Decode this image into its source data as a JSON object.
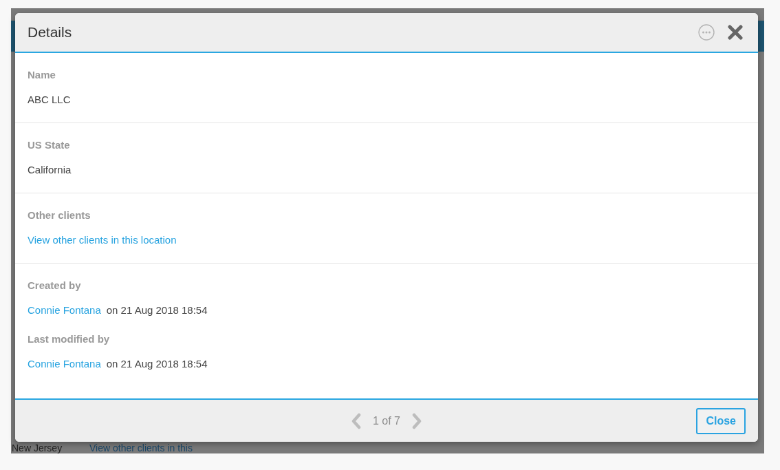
{
  "background": {
    "rows": [
      {
        "state": "New Jersey",
        "link": "View other clients in this"
      }
    ]
  },
  "dialog": {
    "title": "Details",
    "sections": [
      {
        "fields": [
          {
            "kind": "text",
            "label": "Name",
            "value": "ABC LLC"
          }
        ]
      },
      {
        "fields": [
          {
            "kind": "text",
            "label": "US State",
            "value": "California"
          }
        ]
      },
      {
        "fields": [
          {
            "kind": "link",
            "label": "Other clients",
            "value": "View other clients in this location"
          }
        ]
      },
      {
        "fields": [
          {
            "kind": "audit",
            "label": "Created by",
            "user": "Connie Fontana",
            "connector": "on",
            "date": "21 Aug 2018 18:54"
          },
          {
            "kind": "audit",
            "label": "Last modified by",
            "user": "Connie Fontana",
            "connector": "on",
            "date": "21 Aug 2018 18:54"
          }
        ]
      }
    ],
    "footer": {
      "pager": "1 of 7",
      "button": "Close"
    }
  }
}
